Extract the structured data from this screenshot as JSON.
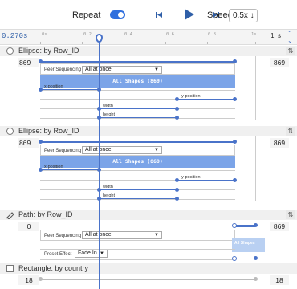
{
  "toolbar": {
    "repeat_label": "Repeat",
    "speed_label": "Speed",
    "speed_value": "0.5x ↕"
  },
  "ruler": {
    "time": "0.270s",
    "ticks": [
      "0s",
      "0.2",
      "0.4",
      "0.6",
      "0.8",
      "1s"
    ],
    "zoom_value": "1",
    "zoom_unit": "s"
  },
  "sections": [
    {
      "title": "Ellipse: by Row_ID",
      "count": "869",
      "peer_label": "Peer Sequencing",
      "peer_value": "All at once",
      "shapes_label": "All Shapes (869)",
      "props": [
        "x-position",
        "y-position",
        "width",
        "height"
      ]
    },
    {
      "title": "Ellipse: by Row_ID",
      "count": "869",
      "peer_label": "Peer Sequencing",
      "peer_value": "All at once",
      "shapes_label": "All Shapes (869)",
      "props": [
        "x-position",
        "y-position",
        "width",
        "height"
      ]
    },
    {
      "title": "Path: by Row_ID",
      "count_left": "0",
      "count_right": "869",
      "peer_label": "Peer Sequencing",
      "peer_value": "All at once",
      "preset_label": "Preset Effect",
      "preset_value": "Fade In",
      "shapes_label": "All Shapes"
    },
    {
      "title": "Rectangle: by country",
      "count": "18"
    }
  ]
}
